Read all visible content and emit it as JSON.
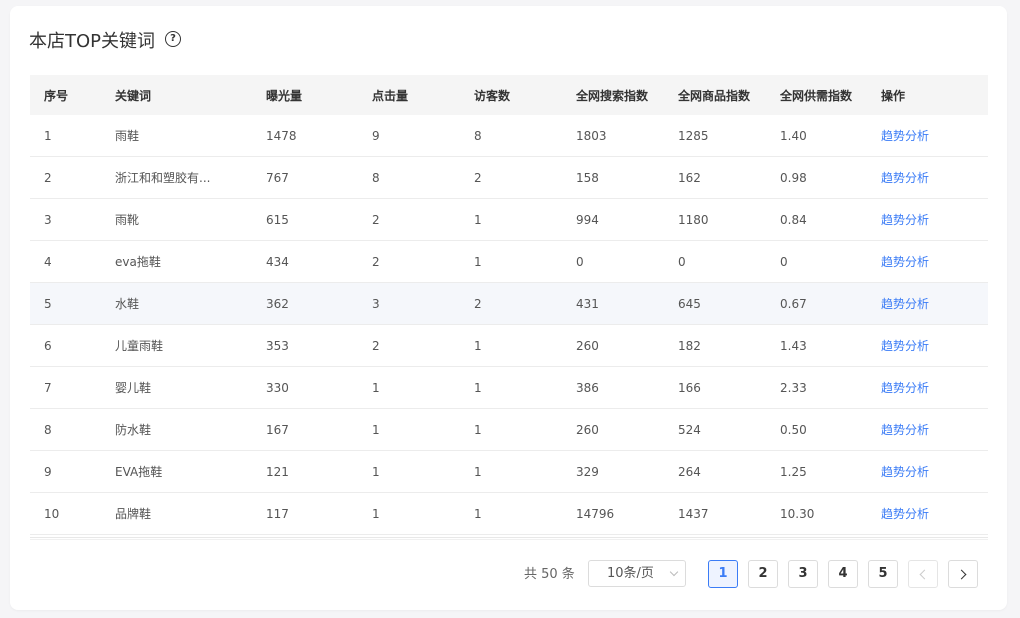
{
  "header": {
    "title": "本店TOP关键词",
    "help_icon": "?"
  },
  "table": {
    "columns": [
      "序号",
      "关键词",
      "曝光量",
      "点击量",
      "访客数",
      "全网搜索指数",
      "全网商品指数",
      "全网供需指数",
      "操作"
    ],
    "rows": [
      {
        "no": "1",
        "keyword": "雨鞋",
        "exposure": "1478",
        "clicks": "9",
        "visitors": "8",
        "search_index": "1803",
        "product_index": "1285",
        "supply_demand": "1.40",
        "action": "趋势分析"
      },
      {
        "no": "2",
        "keyword": "浙江和和塑胶有...",
        "exposure": "767",
        "clicks": "8",
        "visitors": "2",
        "search_index": "158",
        "product_index": "162",
        "supply_demand": "0.98",
        "action": "趋势分析"
      },
      {
        "no": "3",
        "keyword": "雨靴",
        "exposure": "615",
        "clicks": "2",
        "visitors": "1",
        "search_index": "994",
        "product_index": "1180",
        "supply_demand": "0.84",
        "action": "趋势分析"
      },
      {
        "no": "4",
        "keyword": "eva拖鞋",
        "exposure": "434",
        "clicks": "2",
        "visitors": "1",
        "search_index": "0",
        "product_index": "0",
        "supply_demand": "0",
        "action": "趋势分析"
      },
      {
        "no": "5",
        "keyword": "水鞋",
        "exposure": "362",
        "clicks": "3",
        "visitors": "2",
        "search_index": "431",
        "product_index": "645",
        "supply_demand": "0.67",
        "action": "趋势分析"
      },
      {
        "no": "6",
        "keyword": "儿童雨鞋",
        "exposure": "353",
        "clicks": "2",
        "visitors": "1",
        "search_index": "260",
        "product_index": "182",
        "supply_demand": "1.43",
        "action": "趋势分析"
      },
      {
        "no": "7",
        "keyword": "婴儿鞋",
        "exposure": "330",
        "clicks": "1",
        "visitors": "1",
        "search_index": "386",
        "product_index": "166",
        "supply_demand": "2.33",
        "action": "趋势分析"
      },
      {
        "no": "8",
        "keyword": "防水鞋",
        "exposure": "167",
        "clicks": "1",
        "visitors": "1",
        "search_index": "260",
        "product_index": "524",
        "supply_demand": "0.50",
        "action": "趋势分析"
      },
      {
        "no": "9",
        "keyword": "EVA拖鞋",
        "exposure": "121",
        "clicks": "1",
        "visitors": "1",
        "search_index": "329",
        "product_index": "264",
        "supply_demand": "1.25",
        "action": "趋势分析"
      },
      {
        "no": "10",
        "keyword": "品牌鞋",
        "exposure": "117",
        "clicks": "1",
        "visitors": "1",
        "search_index": "14796",
        "product_index": "1437",
        "supply_demand": "10.30",
        "action": "趋势分析"
      }
    ]
  },
  "pagination": {
    "total": "共 50 条",
    "page_size": "10条/页",
    "pages": [
      "1",
      "2",
      "3",
      "4",
      "5"
    ],
    "current": "1",
    "prev_icon": "chevron-left-icon",
    "next_icon": "chevron-right-icon"
  },
  "colors": {
    "accent": "#3b7cf6",
    "header_bg": "#f5f5f5",
    "hover_row": "#f5f7fb"
  }
}
